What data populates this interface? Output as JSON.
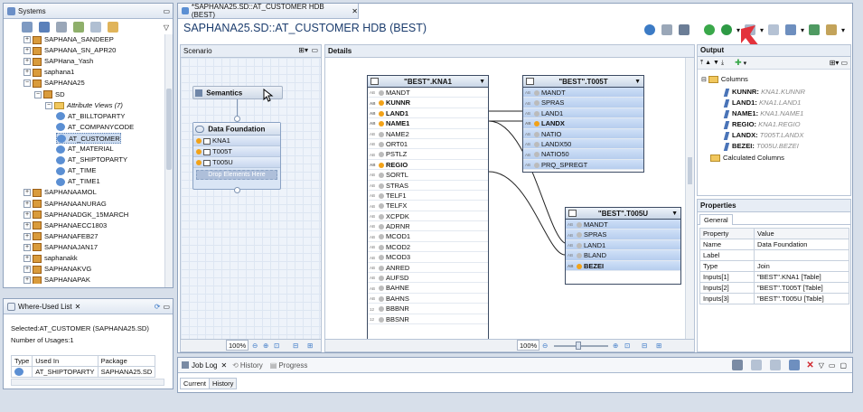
{
  "systems": {
    "tab_label": "Systems",
    "items": [
      {
        "label": "SAPHANA_SANDEEP"
      },
      {
        "label": "SAPHANA_SN_APR20"
      },
      {
        "label": "SAPHana_Yash"
      },
      {
        "label": "saphana1"
      },
      {
        "label": "SAPHANA25"
      },
      {
        "label": "SD"
      },
      {
        "label": "Attribute Views (7)"
      },
      {
        "label": "AT_BILLTOPARTY"
      },
      {
        "label": "AT_COMPANYCODE"
      },
      {
        "label": "AT_CUSTOMER"
      },
      {
        "label": "AT_MATERIAL"
      },
      {
        "label": "AT_SHIPTOPARTY"
      },
      {
        "label": "AT_TIME"
      },
      {
        "label": "AT_TIME1"
      },
      {
        "label": "SAPHANAAMOL"
      },
      {
        "label": "SAPHANAANURAG"
      },
      {
        "label": "SAPHANADGK_15MARCH"
      },
      {
        "label": "SAPHANAECC1803"
      },
      {
        "label": "SAPHANAFEB27"
      },
      {
        "label": "SAPHANAJAN17"
      },
      {
        "label": "saphanakk"
      },
      {
        "label": "SAPHANAKVG"
      },
      {
        "label": "SAPHANAPAK"
      }
    ]
  },
  "where_used": {
    "tab_label": "Where-Used List",
    "selected": "Selected:AT_CUSTOMER  (SAPHANA25.SD)",
    "usages": "Number of Usages:1",
    "columns": [
      "Type",
      "Used In",
      "Package"
    ],
    "rows": [
      {
        "used_in": "AT_SHIPTOPARTY",
        "package": "SAPHANA25.SD"
      }
    ]
  },
  "editor": {
    "tab_label": "*SAPHANA25.SD::AT_CUSTOMER HDB (BEST)",
    "title": "SAPHANA25.SD::AT_CUSTOMER HDB (BEST)"
  },
  "scenario": {
    "header": "Scenario",
    "semantics": "Semantics",
    "data_foundation": "Data Foundation",
    "tables": [
      "KNA1",
      "T005T",
      "T005U"
    ],
    "drop_text": "Drop Elements Here",
    "zoom": "100%"
  },
  "details": {
    "header": "Details",
    "zoom": "100%",
    "kna1": {
      "title": "\"BEST\".KNA1",
      "fields": [
        {
          "name": "MANDT",
          "type": "AB",
          "selected": false
        },
        {
          "name": "KUNNR",
          "type": "AB",
          "selected": true
        },
        {
          "name": "LAND1",
          "type": "AB",
          "selected": true
        },
        {
          "name": "NAME1",
          "type": "AB",
          "selected": true
        },
        {
          "name": "NAME2",
          "type": "AB",
          "selected": false
        },
        {
          "name": "ORT01",
          "type": "AB",
          "selected": false
        },
        {
          "name": "PSTLZ",
          "type": "AB",
          "selected": false
        },
        {
          "name": "REGIO",
          "type": "AB",
          "selected": true
        },
        {
          "name": "SORTL",
          "type": "AB",
          "selected": false
        },
        {
          "name": "STRAS",
          "type": "AB",
          "selected": false
        },
        {
          "name": "TELF1",
          "type": "AB",
          "selected": false
        },
        {
          "name": "TELFX",
          "type": "AB",
          "selected": false
        },
        {
          "name": "XCPDK",
          "type": "AB",
          "selected": false
        },
        {
          "name": "ADRNR",
          "type": "AB",
          "selected": false
        },
        {
          "name": "MCOD1",
          "type": "AB",
          "selected": false
        },
        {
          "name": "MCOD2",
          "type": "AB",
          "selected": false
        },
        {
          "name": "MCOD3",
          "type": "AB",
          "selected": false
        },
        {
          "name": "ANRED",
          "type": "AB",
          "selected": false
        },
        {
          "name": "AUFSD",
          "type": "AB",
          "selected": false
        },
        {
          "name": "BAHNE",
          "type": "AB",
          "selected": false
        },
        {
          "name": "BAHNS",
          "type": "AB",
          "selected": false
        },
        {
          "name": "BBBNR",
          "type": "12",
          "selected": false
        },
        {
          "name": "BBSNR",
          "type": "12",
          "selected": false
        }
      ]
    },
    "t005t": {
      "title": "\"BEST\".T005T",
      "fields": [
        {
          "name": "MANDT",
          "type": "AB",
          "selected": false
        },
        {
          "name": "SPRAS",
          "type": "AB",
          "selected": false
        },
        {
          "name": "LAND1",
          "type": "AB",
          "selected": false
        },
        {
          "name": "LANDX",
          "type": "AB",
          "selected": true
        },
        {
          "name": "NATIO",
          "type": "AB",
          "selected": false
        },
        {
          "name": "LANDX50",
          "type": "AB",
          "selected": false
        },
        {
          "name": "NATIO50",
          "type": "AB",
          "selected": false
        },
        {
          "name": "PRQ_SPREGT",
          "type": "AB",
          "selected": false
        }
      ]
    },
    "t005u": {
      "title": "\"BEST\".T005U",
      "fields": [
        {
          "name": "MANDT",
          "type": "AB",
          "selected": false
        },
        {
          "name": "SPRAS",
          "type": "AB",
          "selected": false
        },
        {
          "name": "LAND1",
          "type": "AB",
          "selected": false
        },
        {
          "name": "BLAND",
          "type": "AB",
          "selected": false
        },
        {
          "name": "BEZEI",
          "type": "AB",
          "selected": true
        }
      ]
    }
  },
  "output": {
    "header": "Output",
    "columns_label": "Columns",
    "columns": [
      {
        "name": "KUNNR:",
        "src": "KNA1.KUNNR"
      },
      {
        "name": "LAND1:",
        "src": "KNA1.LAND1"
      },
      {
        "name": "NAME1:",
        "src": "KNA1.NAME1"
      },
      {
        "name": "REGIO:",
        "src": "KNA1.REGIO"
      },
      {
        "name": "LANDX:",
        "src": "T005T.LANDX"
      },
      {
        "name": "BEZEI:",
        "src": "T005U.BEZEI"
      }
    ],
    "calculated_label": "Calculated Columns"
  },
  "properties": {
    "header": "Properties",
    "tab": "General",
    "columns": [
      "Property",
      "Value"
    ],
    "rows": [
      {
        "p": "Name",
        "v": "Data Foundation"
      },
      {
        "p": "Label",
        "v": ""
      },
      {
        "p": "Type",
        "v": "Join"
      },
      {
        "p": "Inputs[1]",
        "v": "\"BEST\".KNA1 [Table]"
      },
      {
        "p": "Inputs[2]",
        "v": "\"BEST\".T005T [Table]"
      },
      {
        "p": "Inputs[3]",
        "v": "\"BEST\".T005U [Table]"
      }
    ]
  },
  "bottom": {
    "tabs": [
      "Job Log",
      "History",
      "Progress"
    ],
    "subtabs": [
      "Current",
      "History"
    ]
  },
  "colors": {
    "arrow": "#e3323b",
    "title": "#1c3d6e"
  }
}
